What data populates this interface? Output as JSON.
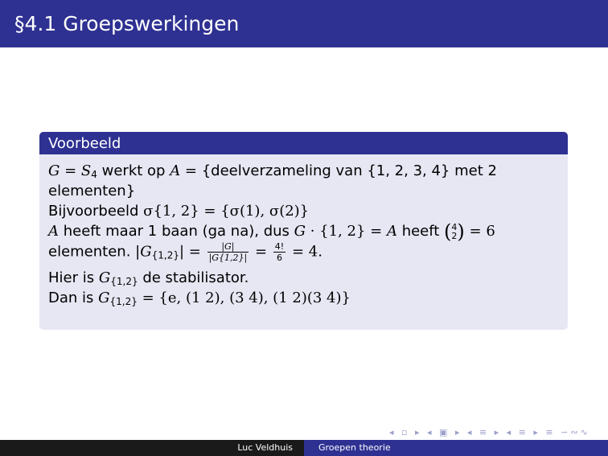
{
  "header": {
    "title": "§4.1 Groepswerkingen"
  },
  "block": {
    "title": "Voorbeeld",
    "line1": {
      "g": "G",
      "eq": " = ",
      "s4": "S",
      "s4sub": "4",
      "t1": " werkt op ",
      "a": "A",
      "eq2": " = ",
      "set": "{deelverzameling van {1, 2, 3, 4} met 2"
    },
    "line2": "elementen}",
    "line3": {
      "t1": "Bijvoorbeeld ",
      "m1": "σ{1, 2} = {σ(1), σ(2)}"
    },
    "line4": {
      "a": "A",
      "t1": " heeft maar 1 baan (ga na), dus ",
      "g": "G",
      "m1": " · {1, 2} = ",
      "a2": "A",
      "t2": " heeft ",
      "binom_top": "4",
      "binom_bot": "2",
      "m2": " = 6"
    },
    "line5": {
      "t1": "elementen. |",
      "g": "G",
      "sub": "{1,2}",
      "m1": "| = ",
      "frac1_num": "|G|",
      "frac1_den": "|G{1,2}|",
      "m2": " = ",
      "frac2_num": "4!",
      "frac2_den": "6",
      "m3": " = 4."
    },
    "line6": {
      "t1": "Hier is ",
      "g": "G",
      "sub": "{1,2}",
      "t2": " de stabilisator."
    },
    "line7": {
      "t1": "Dan is ",
      "g": "G",
      "sub": "{1,2}",
      "m1": " = {e, (1 2), (3 4), (1 2)(3 4)}"
    }
  },
  "nav": {
    "symbols": "◂ ▫ ▸ ◂ ▣ ▸ ◂ ≡ ▸ ◂ ≡ ▸ ≡ ∽∾∿"
  },
  "footer": {
    "author": "Luc Veldhuis",
    "talk": "Groepen theorie"
  }
}
